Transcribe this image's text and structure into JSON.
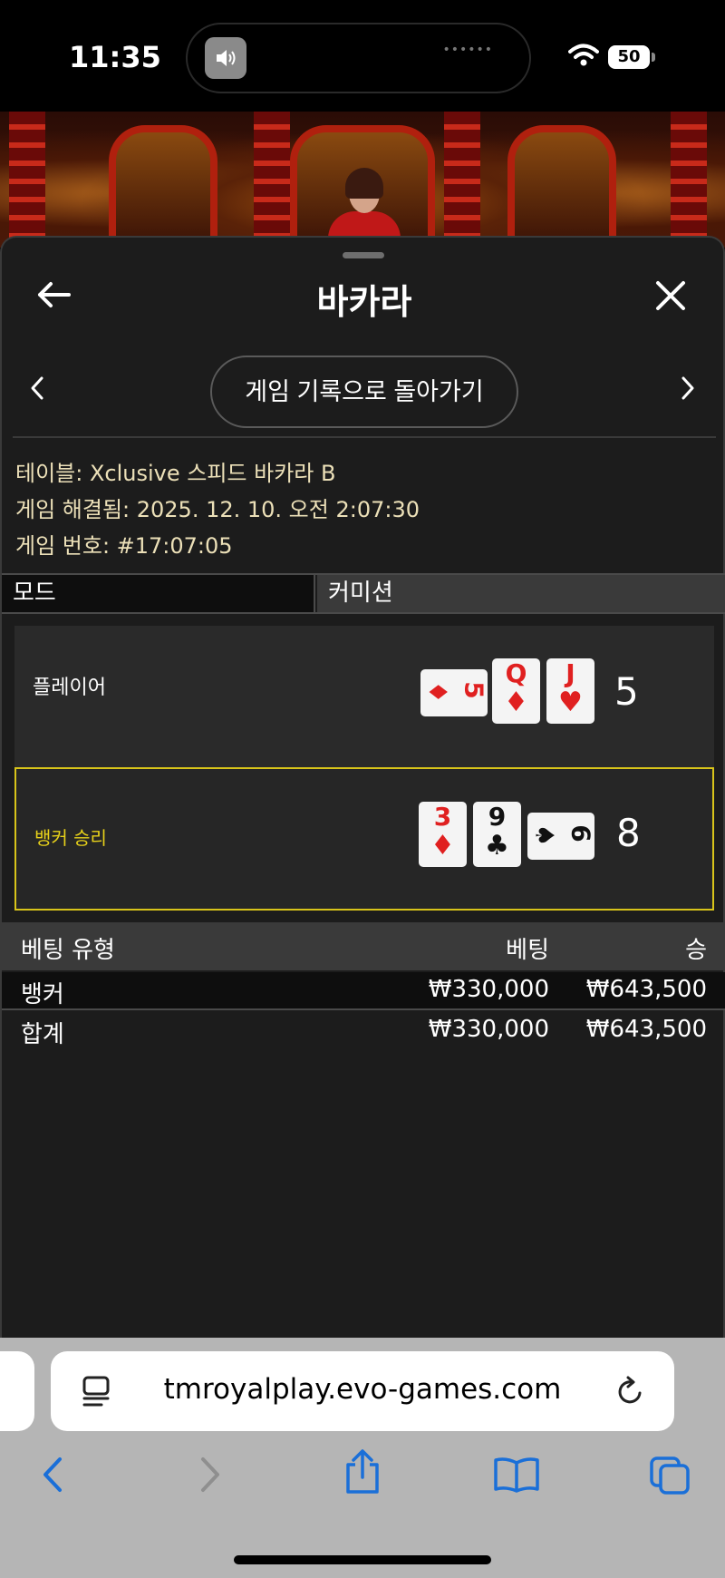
{
  "status_bar": {
    "time": "11:35",
    "battery": "50",
    "island_dots": "••••••"
  },
  "sheet": {
    "title": "바카라",
    "history_button": "게임 기록으로 돌아가기",
    "info": {
      "table": "테이블: Xclusive 스피드 바카라 B",
      "resolved": "게임 해결됨: 2025. 12. 10. 오전 2:07:30",
      "game_number": "게임 번호: #17:07:05"
    },
    "tabs": {
      "mode": "모드",
      "commission": "커미션"
    },
    "player": {
      "label": "플레이어",
      "score": "5",
      "cards": [
        {
          "rank": "5",
          "suit": "♦",
          "color": "red"
        },
        {
          "rank": "Q",
          "suit": "♦",
          "color": "red"
        },
        {
          "rank": "J",
          "suit": "♥",
          "color": "red"
        }
      ]
    },
    "banker": {
      "label": "뱅커 승리",
      "score": "8",
      "cards": [
        {
          "rank": "3",
          "suit": "♦",
          "color": "red"
        },
        {
          "rank": "9",
          "suit": "♣",
          "color": "black"
        },
        {
          "rank": "6",
          "suit": "♠",
          "color": "black"
        }
      ]
    },
    "bets_table": {
      "headers": {
        "type": "베팅 유형",
        "bet": "베팅",
        "win": "승"
      },
      "rows": [
        {
          "type": "뱅커",
          "bet": "₩330,000",
          "win": "₩643,500"
        }
      ],
      "total": {
        "type": "합계",
        "bet": "₩330,000",
        "win": "₩643,500"
      }
    },
    "colors": {
      "winner_border": "#d8c41a",
      "info_text": "#ece0b8",
      "card_red": "#e02020"
    }
  },
  "browser": {
    "url": "tmroyalplay.evo-games.com",
    "icons": [
      "back-icon",
      "forward-icon",
      "share-icon",
      "bookmarks-icon",
      "tabs-icon"
    ]
  }
}
